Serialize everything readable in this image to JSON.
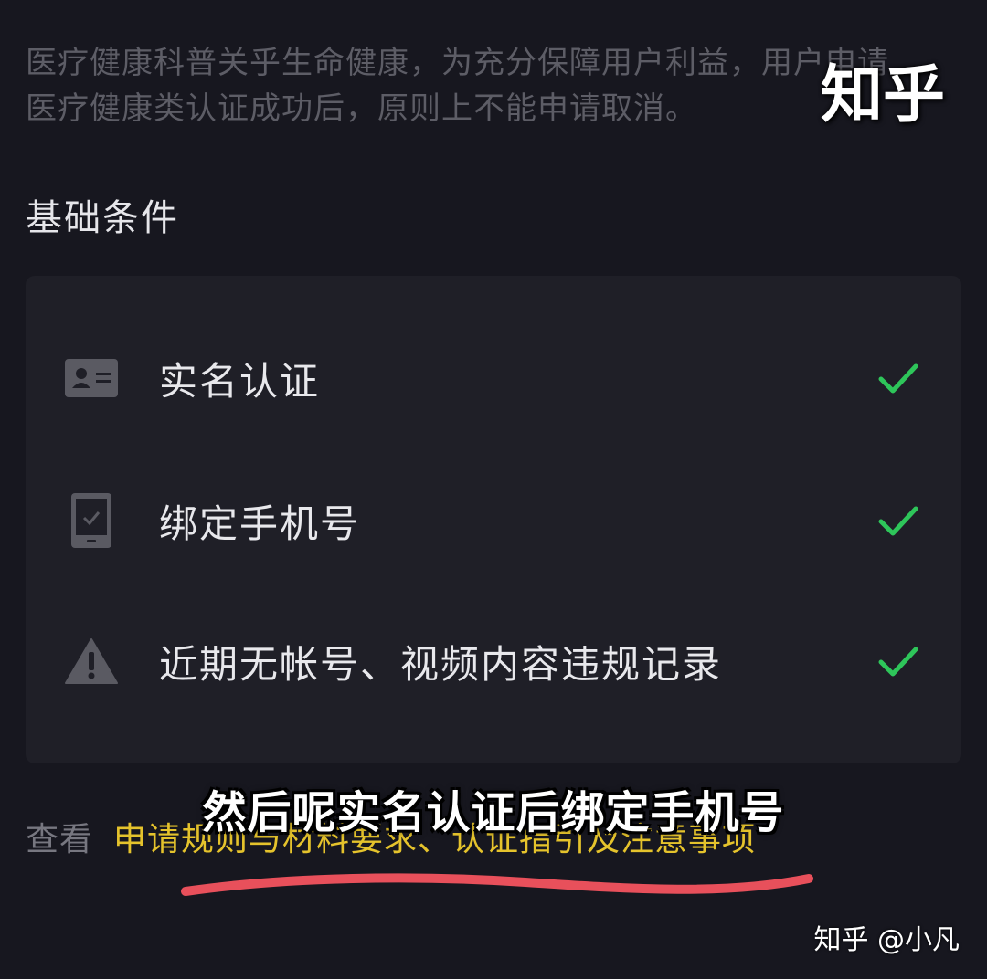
{
  "intro_text": "医疗健康科普关乎生命健康，为充分保障用户利益，用户申请医疗健康类认证成功后，原则上不能申请取消。",
  "watermark_top": "知乎",
  "section_title": "基础条件",
  "conditions": [
    {
      "label": "实名认证",
      "icon": "id-card-icon",
      "status": "checked"
    },
    {
      "label": "绑定手机号",
      "icon": "phone-icon",
      "status": "checked"
    },
    {
      "label": "近期无帐号、视频内容违规记录",
      "icon": "warning-icon",
      "status": "checked"
    }
  ],
  "footer": {
    "prefix": "查看",
    "link": "申请规则与材料要求、认证指引及注意事项"
  },
  "subtitle": "然后呢实名认证后绑定手机号",
  "watermark_bottom": "知乎 @小凡",
  "colors": {
    "background": "#17171f",
    "card": "#1f1f27",
    "check": "#2ec55a",
    "link": "#e5c32c",
    "underline": "#e8505b"
  }
}
